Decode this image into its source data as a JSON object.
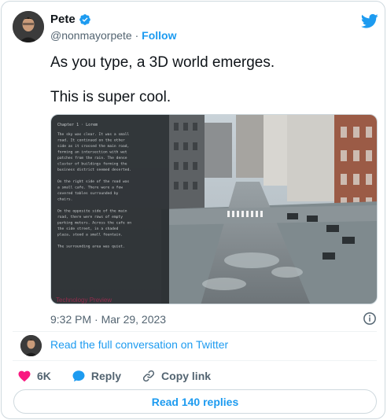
{
  "author": {
    "name": "Pete",
    "handle": "@nonmayorpete",
    "separator": "·",
    "follow_label": "Follow",
    "verified": true
  },
  "tweet": {
    "line1": "As you type, a 3D world emerges.",
    "line2": "This is super cool.",
    "timestamp": "9:32 PM · Mar 29, 2023"
  },
  "media": {
    "overlay_label": "Technology Preview",
    "panel_heading": "Chapter 1 · Lorem",
    "panel_lines": [
      "The sky was clear. It was a small",
      "road. It continued on the other",
      "side as it crossed the main road,",
      "forming an intersection with wet",
      "patches from the rain. The dense",
      "cluster of buildings forming the",
      "business district seemed deserted.",
      "",
      "On the right side of the road was",
      "a small cafe. There were a few",
      "covered tables surrounded by",
      "chairs.",
      "",
      "On the opposite side of the main",
      "road, there were rows of empty",
      "parking meters. Across the cafe on",
      "the side street, in a shaded",
      "plaza, stood a small fountain.",
      "",
      "The surrounding area was quiet."
    ]
  },
  "conversation": {
    "link_label": "Read the full conversation on Twitter"
  },
  "actions": {
    "likes": "6K",
    "reply_label": "Reply",
    "copy_label": "Copy link"
  },
  "replies": {
    "label": "Read 140 replies"
  },
  "colors": {
    "accent": "#1d9bf0",
    "like": "#f91880",
    "text": "#0f1419",
    "muted": "#536471"
  },
  "icons": [
    "verified-badge-icon",
    "twitter-bird-icon",
    "info-icon",
    "heart-icon",
    "reply-bubble-icon",
    "link-icon"
  ]
}
